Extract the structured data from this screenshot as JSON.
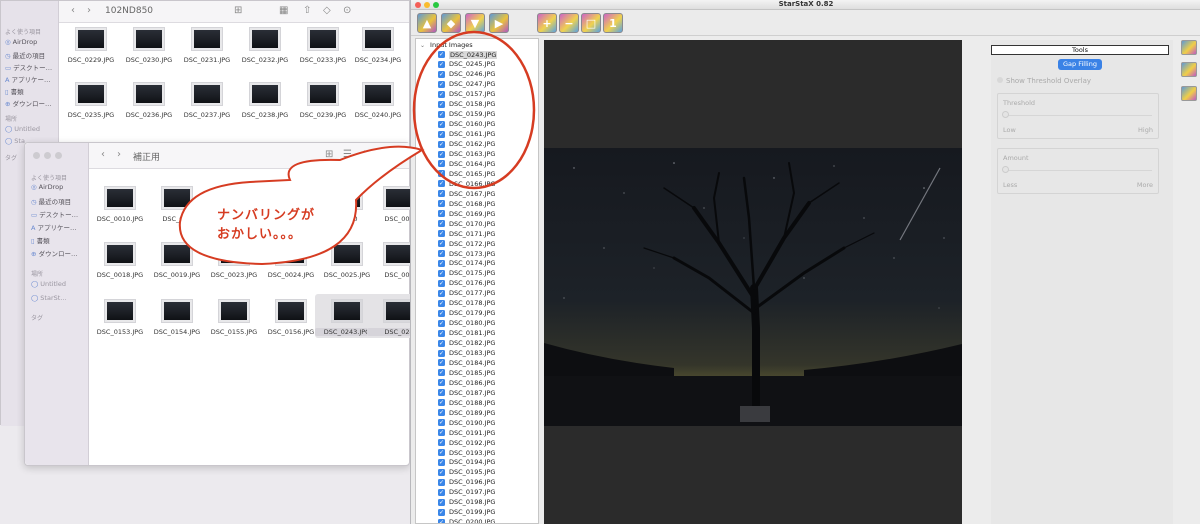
{
  "finder_back": {
    "path_title": "102ND850",
    "sidebar_header": "よく使う項目",
    "sidebar_items": [
      "AirDrop",
      "最近の項目",
      "デスクトー…",
      "アプリケー…",
      "書類",
      "ダウンロー…"
    ],
    "locations_header": "場所",
    "locations": [
      "Untitled",
      "Sta"
    ],
    "tags_header": "タグ",
    "row1": [
      "DSC_0229.JPG",
      "DSC_0230.JPG",
      "DSC_0231.JPG",
      "DSC_0232.JPG",
      "DSC_0233.JPG",
      "DSC_0234.JPG"
    ],
    "row2": [
      "DSC_0235.JPG",
      "DSC_0236.JPG",
      "DSC_0237.JPG",
      "DSC_0238.JPG",
      "DSC_0239.JPG",
      "DSC_0240.JPG"
    ]
  },
  "finder_front": {
    "path_title": "補正用",
    "sidebar_header": "よく使う項目",
    "sidebar_items": [
      "AirDrop",
      "最近の項目",
      "デスクトー…",
      "アプリケー…",
      "書類",
      "ダウンロー…"
    ],
    "locations_header": "場所",
    "locations": [
      "Untitled",
      "StarSt…"
    ],
    "tags_header": "タグ",
    "row1": [
      "DSC_0010.JPG",
      "DSC_001",
      "",
      "",
      "DSC_0",
      "DSC_001"
    ],
    "row2": [
      "DSC_0018.JPG",
      "DSC_0019.JPG",
      "DSC_0023.JPG",
      "DSC_0024.JPG",
      "DSC_0025.JPG",
      "DSC_002"
    ],
    "row3": [
      "DSC_0153.JPG",
      "DSC_0154.JPG",
      "DSC_0155.JPG",
      "DSC_0156.JPG",
      "DSC_0243.JPG",
      "DSC_024"
    ]
  },
  "annotation": {
    "line1": "ナンバリングが",
    "line2": "おかしい。。。",
    "color": "#d63c22"
  },
  "starstax": {
    "title": "StarStaX 0.82",
    "list_header": "Input Images",
    "files": [
      "DSC_0243.JPG",
      "DSC_0245.JPG",
      "DSC_0246.JPG",
      "DSC_0247.JPG",
      "DSC_0157.JPG",
      "DSC_0158.JPG",
      "DSC_0159.JPG",
      "DSC_0160.JPG",
      "DSC_0161.JPG",
      "DSC_0162.JPG",
      "DSC_0163.JPG",
      "DSC_0164.JPG",
      "DSC_0165.JPG",
      "DSC_0166.JPG",
      "DSC_0167.JPG",
      "DSC_0168.JPG",
      "DSC_0169.JPG",
      "DSC_0170.JPG",
      "DSC_0171.JPG",
      "DSC_0172.JPG",
      "DSC_0173.JPG",
      "DSC_0174.JPG",
      "DSC_0175.JPG",
      "DSC_0176.JPG",
      "DSC_0177.JPG",
      "DSC_0178.JPG",
      "DSC_0179.JPG",
      "DSC_0180.JPG",
      "DSC_0181.JPG",
      "DSC_0182.JPG",
      "DSC_0183.JPG",
      "DSC_0184.JPG",
      "DSC_0185.JPG",
      "DSC_0186.JPG",
      "DSC_0187.JPG",
      "DSC_0188.JPG",
      "DSC_0189.JPG",
      "DSC_0190.JPG",
      "DSC_0191.JPG",
      "DSC_0192.JPG",
      "DSC_0193.JPG",
      "DSC_0194.JPG",
      "DSC_0195.JPG",
      "DSC_0196.JPG",
      "DSC_0197.JPG",
      "DSC_0198.JPG",
      "DSC_0199.JPG",
      "DSC_0200.JPG"
    ],
    "tools": {
      "header": "Tools",
      "mode_button": "Gap Filling",
      "show_overlay": "Show Threshold Overlay",
      "threshold": {
        "label": "Threshold",
        "low": "Low",
        "high": "High"
      },
      "amount": {
        "label": "Amount",
        "low": "Less",
        "high": "More"
      }
    },
    "toolbar_icons": [
      "open-images-icon",
      "open-darks-icon",
      "save-icon",
      "start-processing-icon",
      "zoom-in-icon",
      "zoom-out-icon",
      "zoom-fit-icon",
      "zoom-actual-icon"
    ]
  }
}
